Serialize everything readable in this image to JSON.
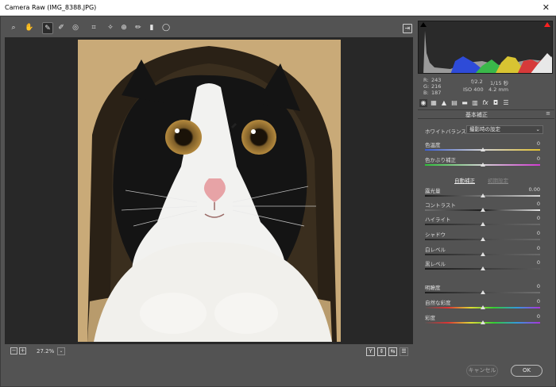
{
  "window": {
    "title": "Camera Raw (IMG_8388.JPG)",
    "close_glyph": "✕"
  },
  "toolbar": {
    "tools": [
      {
        "name": "zoom-tool",
        "icon": "magnifier-icon",
        "glyph": "⌕"
      },
      {
        "name": "hand-tool",
        "icon": "hand-icon",
        "glyph": "✋"
      },
      {
        "name": "white-balance-tool",
        "icon": "eyedropper-icon",
        "glyph": "✎",
        "active": true
      },
      {
        "name": "color-sampler-tool",
        "icon": "color-sampler-icon",
        "glyph": "✐"
      },
      {
        "name": "targeted-adjustment-tool",
        "icon": "target-icon",
        "glyph": "◎"
      },
      {
        "name": "crop-tool",
        "icon": "crop-icon",
        "glyph": "⌗"
      },
      {
        "name": "spot-removal-tool",
        "icon": "spot-removal-icon",
        "glyph": "✧"
      },
      {
        "name": "red-eye-tool",
        "icon": "red-eye-icon",
        "glyph": "⊕"
      },
      {
        "name": "adjustment-brush-tool",
        "icon": "brush-icon",
        "glyph": "✏"
      },
      {
        "name": "graduated-filter-tool",
        "icon": "graduated-filter-icon",
        "glyph": "▮"
      },
      {
        "name": "radial-filter-tool",
        "icon": "radial-filter-icon",
        "glyph": "◯"
      }
    ],
    "export_icon": "export-icon",
    "export_glyph": "⇥"
  },
  "statusbar": {
    "zoom_minus": "−",
    "zoom_plus": "+",
    "zoom": "27.2%",
    "dropdown_glyph": "⌄",
    "view_y": "Y",
    "view_before_after": "⇕",
    "view_swap": "⇆",
    "view_settings": "☰"
  },
  "readout": {
    "r_label": "R:",
    "r_value": "243",
    "g_label": "G:",
    "g_value": "216",
    "b_label": "B:",
    "b_value": "187",
    "aperture": "f/2.2",
    "shutter": "1/15 秒",
    "iso": "ISO 400",
    "focal": "4.2 mm"
  },
  "panel_tabs": [
    {
      "name": "tab-basic",
      "icon": "aperture-icon",
      "glyph": "◉",
      "active": true
    },
    {
      "name": "tab-tone-curve",
      "icon": "tone-curve-icon",
      "glyph": "▦"
    },
    {
      "name": "tab-detail",
      "icon": "detail-icon",
      "glyph": "▲"
    },
    {
      "name": "tab-hsl",
      "icon": "hsl-icon",
      "glyph": "▤"
    },
    {
      "name": "tab-split-toning",
      "icon": "split-toning-icon",
      "glyph": "▬"
    },
    {
      "name": "tab-lens",
      "icon": "lens-icon",
      "glyph": "▥"
    },
    {
      "name": "tab-effects",
      "icon": "fx-icon",
      "glyph": "fx"
    },
    {
      "name": "tab-camera-calibration",
      "icon": "camera-icon",
      "glyph": "◘"
    },
    {
      "name": "tab-presets",
      "icon": "presets-icon",
      "glyph": "☰"
    }
  ],
  "panel": {
    "title": "基本補正",
    "menu_glyph": "≡",
    "wb_label": "ホワイトバランス：",
    "wb_value": "撮影時の設定",
    "auto_label": "自動補正",
    "default_label": "初期設定",
    "sliders": {
      "temperature": {
        "label": "色温度",
        "value": "0",
        "level": 0.5
      },
      "tint": {
        "label": "色かぶり補正",
        "value": "0",
        "level": 0.5
      },
      "exposure": {
        "label": "露光量",
        "value": "0.00",
        "level": 0.5
      },
      "contrast": {
        "label": "コントラスト",
        "value": "0",
        "level": 0.5
      },
      "highlights": {
        "label": "ハイライト",
        "value": "0",
        "level": 0.5
      },
      "shadows": {
        "label": "シャドウ",
        "value": "0",
        "level": 0.5
      },
      "whites": {
        "label": "白レベル",
        "value": "0",
        "level": 0.5
      },
      "blacks": {
        "label": "黒レベル",
        "value": "0",
        "level": 0.5
      },
      "clarity": {
        "label": "明瞭度",
        "value": "0",
        "level": 0.5
      },
      "vibrance": {
        "label": "自然な彩度",
        "value": "0",
        "level": 0.5
      },
      "saturation": {
        "label": "彩度",
        "value": "0",
        "level": 0.5
      }
    }
  },
  "buttons": {
    "cancel": "キャンセル",
    "ok": "OK"
  },
  "colors": {
    "clip_shadow": "#000000",
    "clip_highlight": "#ff2020",
    "panel_bg": "#535353",
    "canvas_bg": "#282828"
  }
}
